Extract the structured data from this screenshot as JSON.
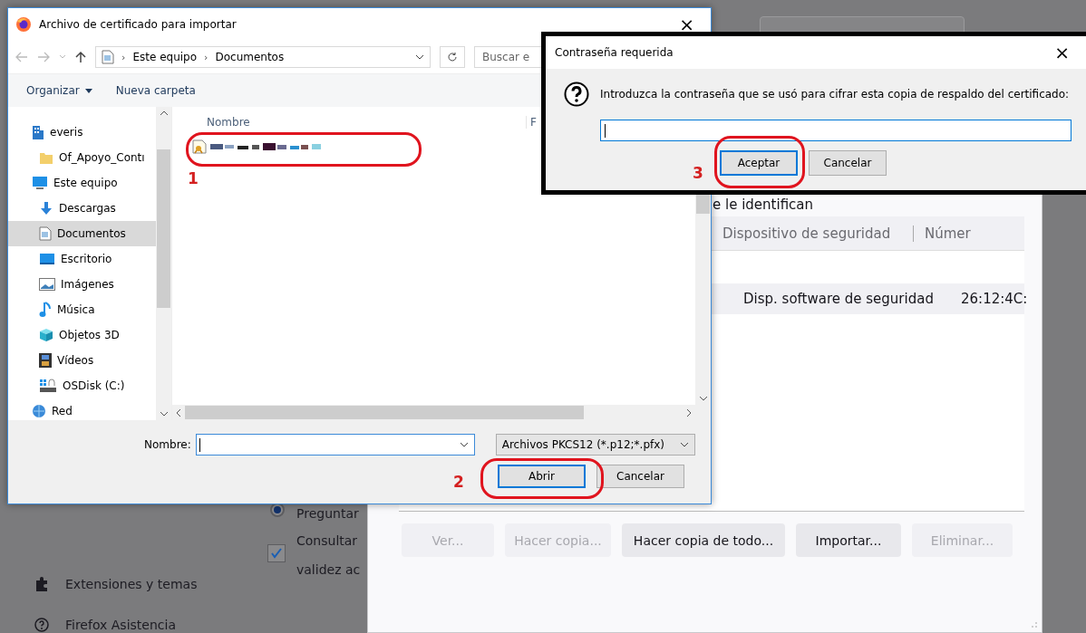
{
  "background_page": {
    "sidebar": [
      {
        "label": "Extensiones y temas"
      },
      {
        "label": "Firefox Asistencia"
      }
    ],
    "radio": {
      "label": "Preguntar",
      "selected": true
    },
    "checkbox": {
      "lines": [
        "Consultar",
        "validez ac"
      ],
      "checked": true
    }
  },
  "certificate_manager": {
    "caption": "e le identifican",
    "columns": [
      "Dispositivo de seguridad",
      "Númer"
    ],
    "rows": [
      {
        "cells": [
          "Disp. software de seguridad",
          "26:12:4C:"
        ]
      }
    ],
    "buttons": [
      {
        "label": "Ver...",
        "disabled": true
      },
      {
        "label": "Hacer copia...",
        "disabled": true
      },
      {
        "label": "Hacer copia de todo...",
        "disabled": false
      },
      {
        "label": "Importar...",
        "disabled": false
      },
      {
        "label": "Eliminar...",
        "disabled": true
      }
    ]
  },
  "file_dialog": {
    "title": "Archivo de certificado para importar",
    "close": "×",
    "breadcrumb": [
      "Este equipo",
      "Documentos"
    ],
    "breadcrumb_separator": "›",
    "search_placeholder": "Buscar e",
    "toolbar": [
      "Organizar",
      "Nueva carpeta"
    ],
    "nav_items": [
      {
        "label": "everis",
        "selected": false,
        "children": [
          {
            "label": "Of_Apoyo_Contı",
            "selected": false
          }
        ]
      },
      {
        "label": "Este equipo",
        "selected": false,
        "children": [
          {
            "label": "Descargas",
            "selected": false
          },
          {
            "label": "Documentos",
            "selected": true
          },
          {
            "label": "Escritorio",
            "selected": false
          },
          {
            "label": "Imágenes",
            "selected": false
          },
          {
            "label": "Música",
            "selected": false
          },
          {
            "label": "Objetos 3D",
            "selected": false
          },
          {
            "label": "Vídeos",
            "selected": false
          },
          {
            "label": "OSDisk (C:)",
            "selected": false
          }
        ]
      },
      {
        "label": "Red",
        "selected": false
      }
    ],
    "columns": [
      "Nombre",
      "F"
    ],
    "files": [
      {
        "kind": "redacted"
      }
    ],
    "filename_label": "Nombre:",
    "filter": "Archivos PKCS12 (*.p12;*.pfx)",
    "buttons": [
      {
        "label": "Abrir",
        "default": true
      },
      {
        "label": "Cancelar",
        "default": false
      }
    ]
  },
  "password_dialog": {
    "title": "Contraseña requerida",
    "close": "×",
    "message": "Introduzca la contraseña que se usó para cifrar esta copia de respaldo del certificado:",
    "buttons": [
      {
        "label": "Aceptar",
        "default": true
      },
      {
        "label": "Cancelar",
        "default": false
      }
    ]
  },
  "annotations": [
    {
      "label": "1"
    },
    {
      "label": "2"
    },
    {
      "label": "3"
    }
  ]
}
